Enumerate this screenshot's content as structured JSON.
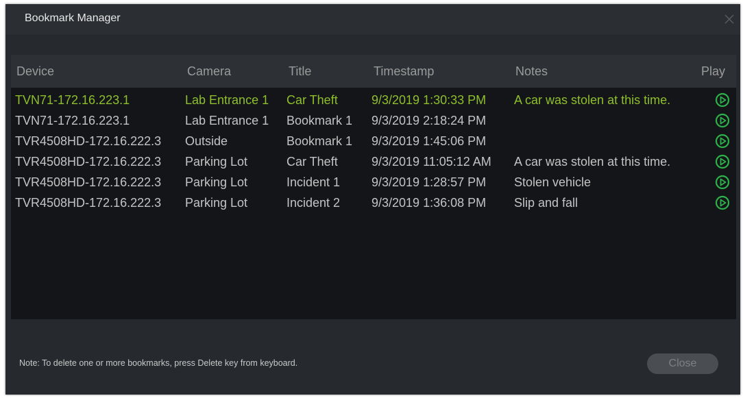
{
  "window": {
    "title": "Bookmark Manager"
  },
  "table": {
    "headers": {
      "device": "Device",
      "camera": "Camera",
      "title": "Title",
      "timestamp": "Timestamp",
      "notes": "Notes",
      "play": "Play"
    },
    "rows": [
      {
        "device": "TVN71-172.16.223.1",
        "camera": "Lab Entrance 1",
        "title": "Car Theft",
        "timestamp": "9/3/2019 1:30:33 PM",
        "notes": "A car was stolen at this time.",
        "selected": true
      },
      {
        "device": "TVN71-172.16.223.1",
        "camera": "Lab Entrance 1",
        "title": "Bookmark 1",
        "timestamp": "9/3/2019 2:18:24 PM",
        "notes": "",
        "selected": false
      },
      {
        "device": "TVR4508HD-172.16.222.3",
        "camera": "Outside",
        "title": "Bookmark 1",
        "timestamp": "9/3/2019 1:45:06 PM",
        "notes": "",
        "selected": false
      },
      {
        "device": "TVR4508HD-172.16.222.3",
        "camera": "Parking Lot",
        "title": "Car Theft",
        "timestamp": "9/3/2019 11:05:12 AM",
        "notes": "A car was stolen at this time.",
        "selected": false
      },
      {
        "device": "TVR4508HD-172.16.222.3",
        "camera": "Parking Lot",
        "title": "Incident 1",
        "timestamp": "9/3/2019 1:28:57 PM",
        "notes": "Stolen vehicle",
        "selected": false
      },
      {
        "device": "TVR4508HD-172.16.222.3",
        "camera": "Parking Lot",
        "title": "Incident 2",
        "timestamp": "9/3/2019 1:36:08 PM",
        "notes": "Slip and fall",
        "selected": false
      }
    ]
  },
  "footer": {
    "note": "Note: To delete one or more bookmarks, press Delete key from keyboard.",
    "close_label": "Close"
  },
  "colors": {
    "selected_text": "#8fbf2a",
    "play_icon": "#2db24a"
  },
  "icons": {
    "close": "close-icon",
    "play": "play-circle-icon"
  }
}
